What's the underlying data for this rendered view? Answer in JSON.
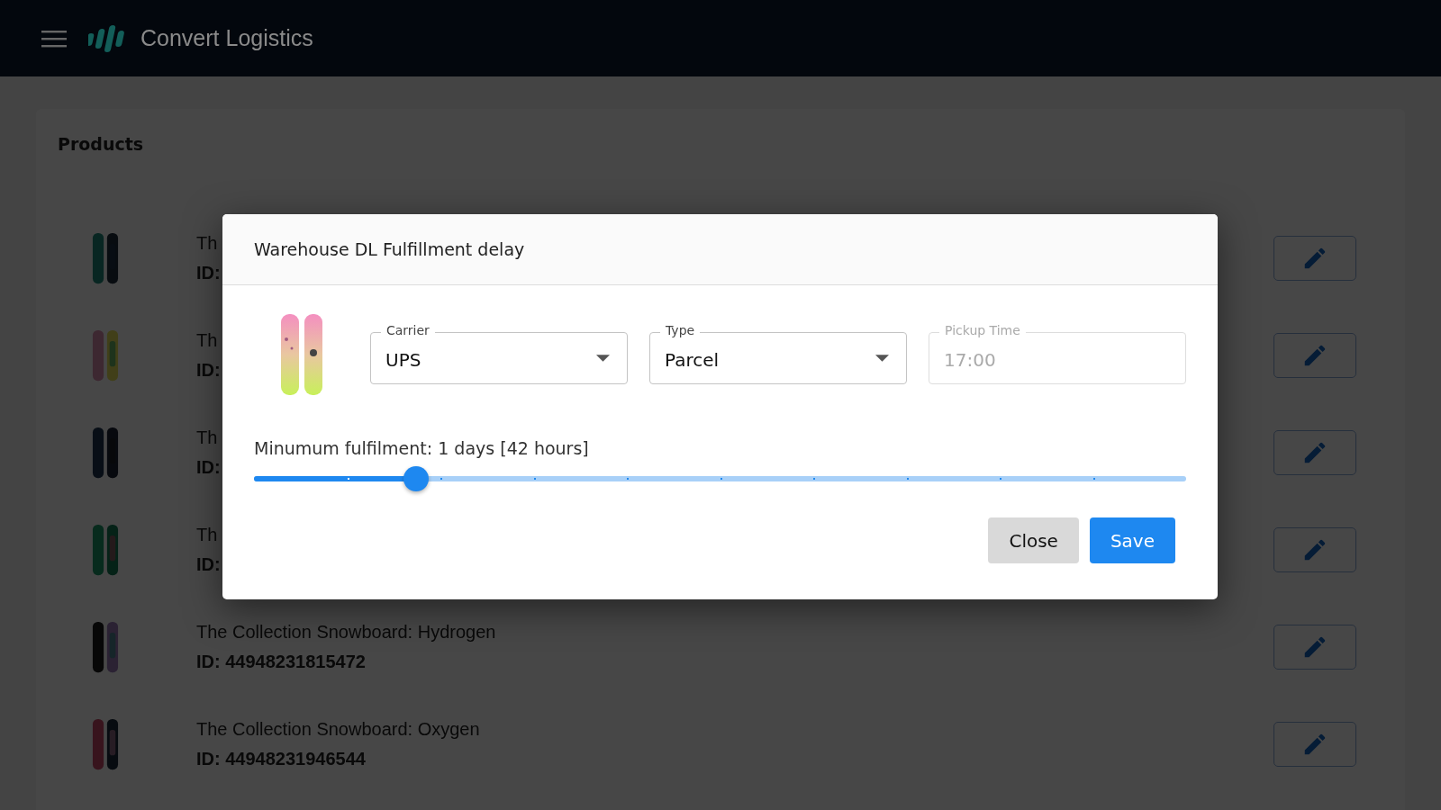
{
  "app_bar": {
    "title": "Convert Logistics"
  },
  "page": {
    "title": "Products"
  },
  "products": [
    {
      "name": "Th",
      "id": "ID:",
      "kind": "picture"
    },
    {
      "name": "Th",
      "id": "ID:",
      "kind": "picture"
    },
    {
      "name": "Th",
      "id": "ID:",
      "kind": "picture"
    },
    {
      "name": "Th",
      "id": "ID:",
      "kind": "picture"
    },
    {
      "name": "The Collection Snowboard: Hydrogen",
      "id": "ID: 44948231815472",
      "kind": "picture"
    },
    {
      "name": "The Collection Snowboard: Oxygen",
      "id": "ID: 44948231946544",
      "kind": "picture"
    }
  ],
  "dialog": {
    "title": "Warehouse DL Fulfillment delay",
    "fields": [
      {
        "kind": "select",
        "label": "Carrier",
        "value": "UPS",
        "disabled": false
      },
      {
        "kind": "select",
        "label": "Type",
        "value": "Parcel",
        "disabled": false
      },
      {
        "kind": "input",
        "label": "Pickup Time",
        "value": "17:00",
        "disabled": true
      }
    ],
    "slider": {
      "label": "Minumum fulfilment: 1 days [42 hours]",
      "level": 0.174
    },
    "buttons": [
      {
        "label": "Close",
        "kind": "secondary"
      },
      {
        "label": "Save",
        "kind": "primary"
      }
    ]
  }
}
